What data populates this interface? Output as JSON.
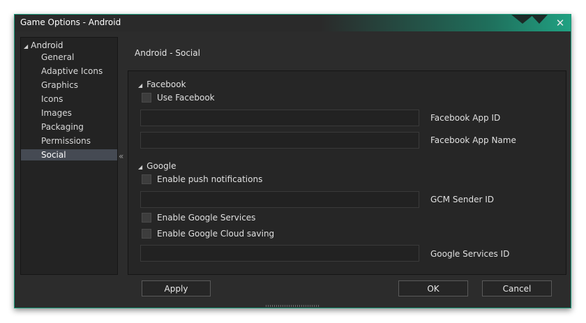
{
  "window": {
    "title": "Game Options - Android",
    "close_glyph": "✕"
  },
  "sidebar": {
    "root_label": "Android",
    "items": [
      {
        "label": "General",
        "selected": false
      },
      {
        "label": "Adaptive Icons",
        "selected": false
      },
      {
        "label": "Graphics",
        "selected": false
      },
      {
        "label": "Icons",
        "selected": false
      },
      {
        "label": "Images",
        "selected": false
      },
      {
        "label": "Packaging",
        "selected": false
      },
      {
        "label": "Permissions",
        "selected": false
      },
      {
        "label": "Social",
        "selected": true
      }
    ],
    "collapse_glyph": "«"
  },
  "page": {
    "heading": "Android - Social"
  },
  "facebook": {
    "header": "Facebook",
    "use_facebook_label": "Use Facebook",
    "use_facebook_checked": false,
    "app_id_label": "Facebook App ID",
    "app_id_value": "",
    "app_name_label": "Facebook App Name",
    "app_name_value": ""
  },
  "google": {
    "header": "Google",
    "push_label": "Enable push notifications",
    "push_checked": false,
    "gcm_label": "GCM Sender ID",
    "gcm_value": "",
    "services_label": "Enable Google Services",
    "services_checked": false,
    "cloud_label": "Enable Google Cloud saving",
    "cloud_checked": false,
    "services_id_label": "Google Services ID",
    "services_id_value": ""
  },
  "buttons": {
    "apply": "Apply",
    "ok": "OK",
    "cancel": "Cancel"
  },
  "colors": {
    "accent": "#20a182",
    "background": "#2c2c2c",
    "selection": "#454a53"
  }
}
